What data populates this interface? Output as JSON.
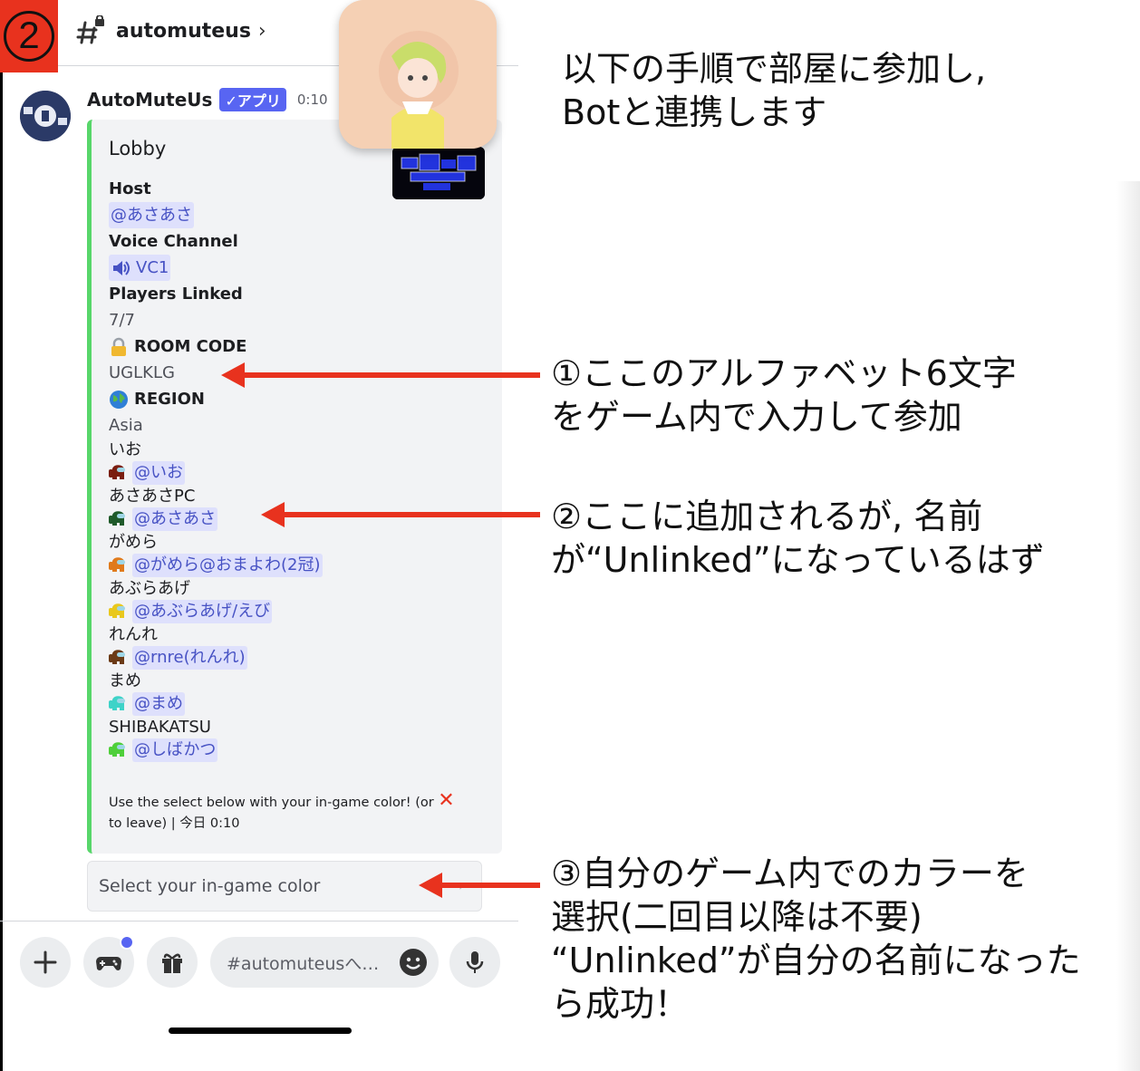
{
  "step_badge": "2",
  "channel": {
    "name": "automuteus",
    "chevron": "›"
  },
  "message": {
    "author": "AutoMuteUs",
    "app_badge": "✓アプリ",
    "time": "0:10"
  },
  "embed": {
    "title": "Lobby",
    "fields": [
      {
        "name": "Host",
        "value": "@あさあさ",
        "mention": true
      },
      {
        "name": "Voice Channel",
        "value": "VC1",
        "mention": true,
        "icon": "speaker-icon"
      },
      {
        "name": "Players Linked",
        "value": "7/7",
        "mention": false
      },
      {
        "name": "ROOM CODE",
        "name_icon": "lock-icon",
        "value": "UGLKLG",
        "mention": false
      },
      {
        "name": "REGION",
        "name_icon": "globe-icon",
        "value": "Asia",
        "mention": false
      }
    ],
    "players": [
      {
        "name": "いお",
        "mention": "@いお",
        "color": "#7a1e10"
      },
      {
        "name": "あさあさPC",
        "mention": "@あさあさ",
        "color": "#1f5a2a"
      },
      {
        "name": "がめら",
        "mention": "@がめら@おまよわ(2冠)",
        "color": "#e07a1b"
      },
      {
        "name": "あぶらあげ",
        "mention": "@あぶらあげ/えび",
        "color": "#e9c81d"
      },
      {
        "name": "れんれ",
        "mention": "@rnre(れんれ)",
        "color": "#6b3a16"
      },
      {
        "name": "まめ",
        "mention": "@まめ",
        "color": "#3ed3c8"
      },
      {
        "name": "SHIBAKATSU",
        "mention": "@しばかつ",
        "color": "#4fcf3a"
      }
    ],
    "footer_line1": "Use the select below with your in-game color! (or ",
    "footer_x": "✕",
    "footer_line2": "to leave) | 今日 0:10"
  },
  "select": {
    "placeholder": "Select your in-game color",
    "chevron": "›"
  },
  "composer": {
    "placeholder": "#automuteusへ…"
  },
  "annotations": {
    "intro": "以下の手順で部屋に参加し,\nBotと連携します",
    "step1": "①ここのアルファベット6文字\nをゲーム内で入力して参加",
    "step2": "②ここに追加されるが, 名前\nが“Unlinked”になっているはず",
    "step3": "③自分のゲーム内でのカラーを\n選択(二回目以降は不要)\n“Unlinked”が自分の名前になった\nら成功！"
  },
  "colors": {
    "accent": "#e8321e",
    "embed_bar": "#57d66a",
    "mention_bg": "#dee0fc",
    "brand": "#5865f2"
  }
}
